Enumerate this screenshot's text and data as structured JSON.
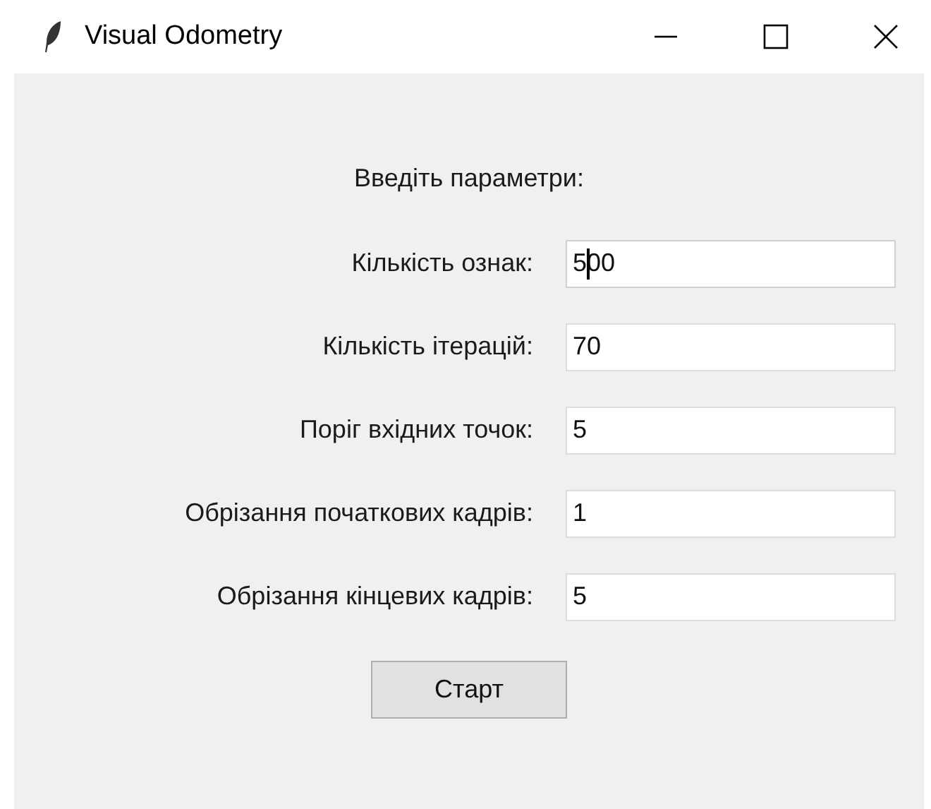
{
  "window": {
    "title": "Visual Odometry"
  },
  "heading": "Введіть параметри:",
  "fields": [
    {
      "label": "Кількість ознак:",
      "value": "500",
      "focused": true
    },
    {
      "label": "Кількість ітерацій:",
      "value": "70",
      "focused": false
    },
    {
      "label": "Поріг вхідних точок:",
      "value": "5",
      "focused": false
    },
    {
      "label": "Обрізання початкових кадрів:",
      "value": "1",
      "focused": false
    },
    {
      "label": "Обрізання кінцевих кадрів:",
      "value": "5",
      "focused": false
    }
  ],
  "button": "Старт"
}
